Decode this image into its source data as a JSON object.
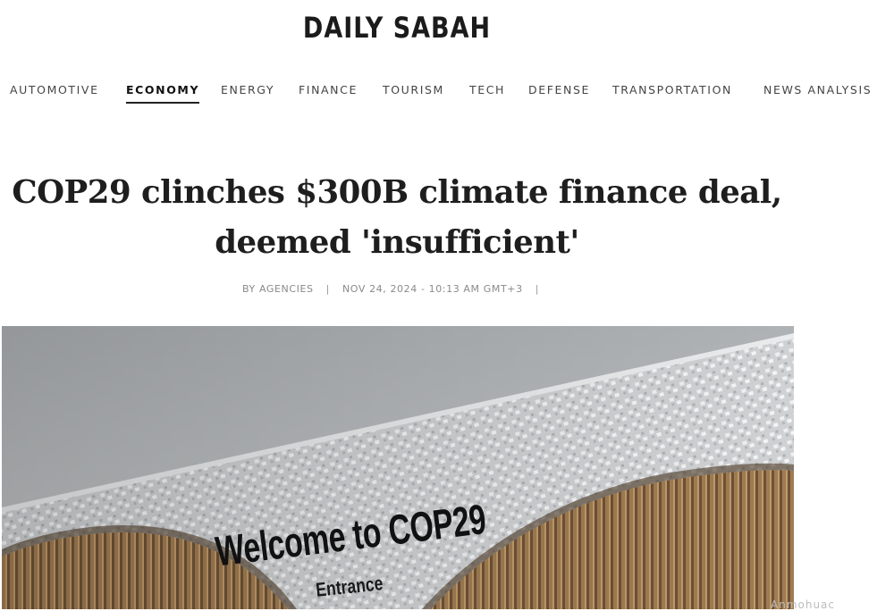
{
  "site": {
    "logo_text": "DAILY SABAH"
  },
  "nav": {
    "items": [
      {
        "label": "AUTOMOTIVE"
      },
      {
        "label": "ECONOMY",
        "active": true
      },
      {
        "label": "ENERGY"
      },
      {
        "label": "FINANCE"
      },
      {
        "label": "TOURISM"
      },
      {
        "label": "TECH"
      },
      {
        "label": "DEFENSE"
      },
      {
        "label": "TRANSPORTATION"
      },
      {
        "label": "NEWS ANALYSIS"
      }
    ]
  },
  "article": {
    "headline_line1": "COP29 clinches $300B climate finance deal,",
    "headline_line2": "deemed 'insufficient'",
    "byline": "BY AGENCIES",
    "separator": "|",
    "date": "NOV 24, 2024 - 10:13 AM GMT+3"
  },
  "hero_image": {
    "sign_text": "Welcome to COP29",
    "sign_subtext": "Entrance"
  },
  "ad": {
    "fragment_text": "Anmohuac"
  },
  "colors": {
    "sky": "#b9bcbe",
    "facade": "#d8d9da",
    "bronze": "#8a6a45",
    "text_dark": "#1e1e1e",
    "meta_gray": "#8a8a8a"
  }
}
